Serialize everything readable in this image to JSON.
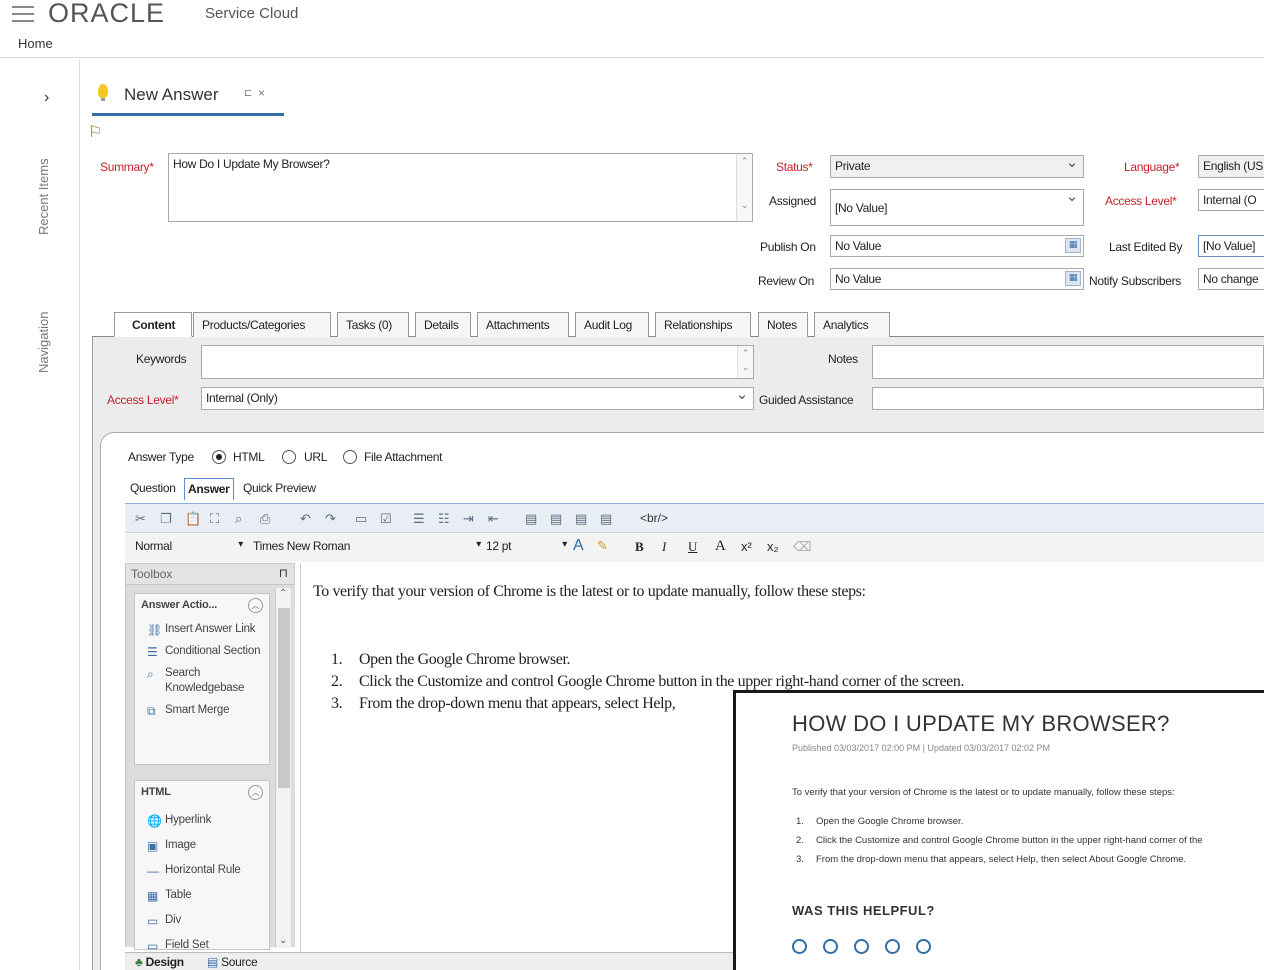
{
  "header": {
    "logo": "ORACLE",
    "product": "Service Cloud",
    "home": "Home"
  },
  "rail": {
    "recent_items": "Recent Items",
    "navigation": "Navigation"
  },
  "doc_tab": {
    "title": "New Answer",
    "pin": "⊏",
    "close": "×"
  },
  "form": {
    "summary_label": "Summary",
    "summary_value": "How Do I Update My Browser?",
    "status_label": "Status",
    "status_value": "Private",
    "assigned_label": "Assigned",
    "assigned_value": "[No Value]",
    "publish_on_label": "Publish On",
    "publish_on_value": "No Value",
    "review_on_label": "Review On",
    "review_on_value": "No Value",
    "language_label": "Language",
    "language_value": "English (US",
    "access_level_label": "Access Level",
    "access_level_value": "Internal (O",
    "last_edited_label": "Last Edited By",
    "last_edited_value": "[No Value]",
    "notify_label": "Notify Subscribers",
    "notify_value": "No change",
    "req": "*"
  },
  "tabs": [
    "Content",
    "Products/Categories",
    "Tasks (0)",
    "Details",
    "Attachments",
    "Audit Log",
    "Relationships",
    "Notes",
    "Analytics"
  ],
  "content": {
    "keywords_label": "Keywords",
    "notes_label": "Notes",
    "access_level_label": "Access Level",
    "access_level_value": "Internal (Only)",
    "guided_label": "Guided Assistance"
  },
  "answer": {
    "type_label": "Answer Type",
    "type_html": "HTML",
    "type_url": "URL",
    "type_file": "File Attachment",
    "subtabs": [
      "Question",
      "Answer",
      "Quick Preview"
    ]
  },
  "toolbar": {
    "br_tag": "<br/>",
    "style_value": "Normal",
    "font_value": "Times New Roman",
    "size_value": "12 pt",
    "bold": "B",
    "italic": "I",
    "underline": "U",
    "font_a": "A",
    "sup": "x²",
    "sub": "x₂"
  },
  "toolbox": {
    "title": "Toolbox",
    "pin": "⊓",
    "group1_title": "Answer Actio...",
    "group1_items": [
      "Insert Answer Link",
      "Conditional Section",
      "Search Knowledgebase",
      "Smart Merge"
    ],
    "group2_title": "HTML",
    "group2_items": [
      "Hyperlink",
      "Image",
      "Horizontal Rule",
      "Table",
      "Div",
      "Field Set"
    ]
  },
  "editor": {
    "intro": "To verify that your version of Chrome is the latest or to update manually, follow these steps:",
    "steps": [
      "Open the Google Chrome browser.",
      "Click the Customize and control Google Chrome button in the upper right-hand corner of the screen.",
      "From the drop-down menu that appears, select Help,"
    ],
    "nums": [
      "1.",
      "2.",
      "3."
    ]
  },
  "bottom_tabs": [
    "Design",
    "Source"
  ],
  "preview": {
    "title": "HOW DO I UPDATE MY BROWSER?",
    "meta": "Published 03/03/2017 02:00 PM   |   Updated 03/03/2017 02:02 PM",
    "intro": "To verify that your version of Chrome is the latest or to update manually, follow these steps:",
    "steps": [
      "Open the Google Chrome browser.",
      "Click the Customize and control Google Chrome button in the upper right-hand corner of the",
      "From the drop-down menu that appears, select Help, then select About Google Chrome."
    ],
    "nums": [
      "1.",
      "2.",
      "3."
    ],
    "helpful": "WAS THIS HELPFUL?",
    "rating_count": 5
  },
  "colors": {
    "accent": "#2f6ea6",
    "required": "#c8202a"
  }
}
